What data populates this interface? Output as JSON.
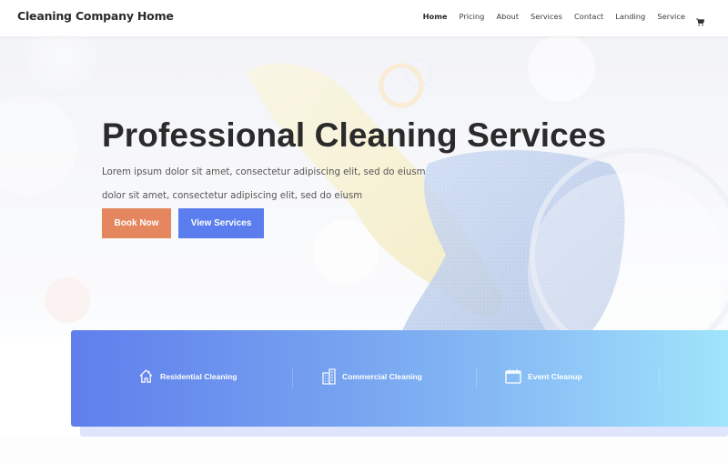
{
  "header": {
    "site_title": "Cleaning Company Home",
    "nav": [
      {
        "label": "Home",
        "active": true
      },
      {
        "label": "Pricing"
      },
      {
        "label": "About"
      },
      {
        "label": "Services"
      },
      {
        "label": "Contact"
      },
      {
        "label": "Landing"
      },
      {
        "label": "Service"
      }
    ],
    "cart_icon": "shopping-cart-icon"
  },
  "hero": {
    "title": "Professional Cleaning Services",
    "subtitle_line1": "Lorem ipsum dolor sit amet, consectetur adipiscing elit, sed do eiusm",
    "subtitle_line2": "dolor sit amet, consectetur adipiscing elit, sed do eiusm",
    "buttons": {
      "book_label": "Book Now",
      "view_label": "View Services"
    }
  },
  "services": [
    {
      "label": "Residential Cleaning",
      "icon": "house-icon"
    },
    {
      "label": "Commercial Cleaning",
      "icon": "building-icon"
    },
    {
      "label": "Event Cleanup",
      "icon": "calendar-icon"
    }
  ],
  "colors": {
    "book_button": "#e4875f",
    "view_button": "#5b7ded",
    "band_start": "#5f7eec",
    "band_end": "#a0e5fb",
    "title_text": "#2b2b2b"
  }
}
